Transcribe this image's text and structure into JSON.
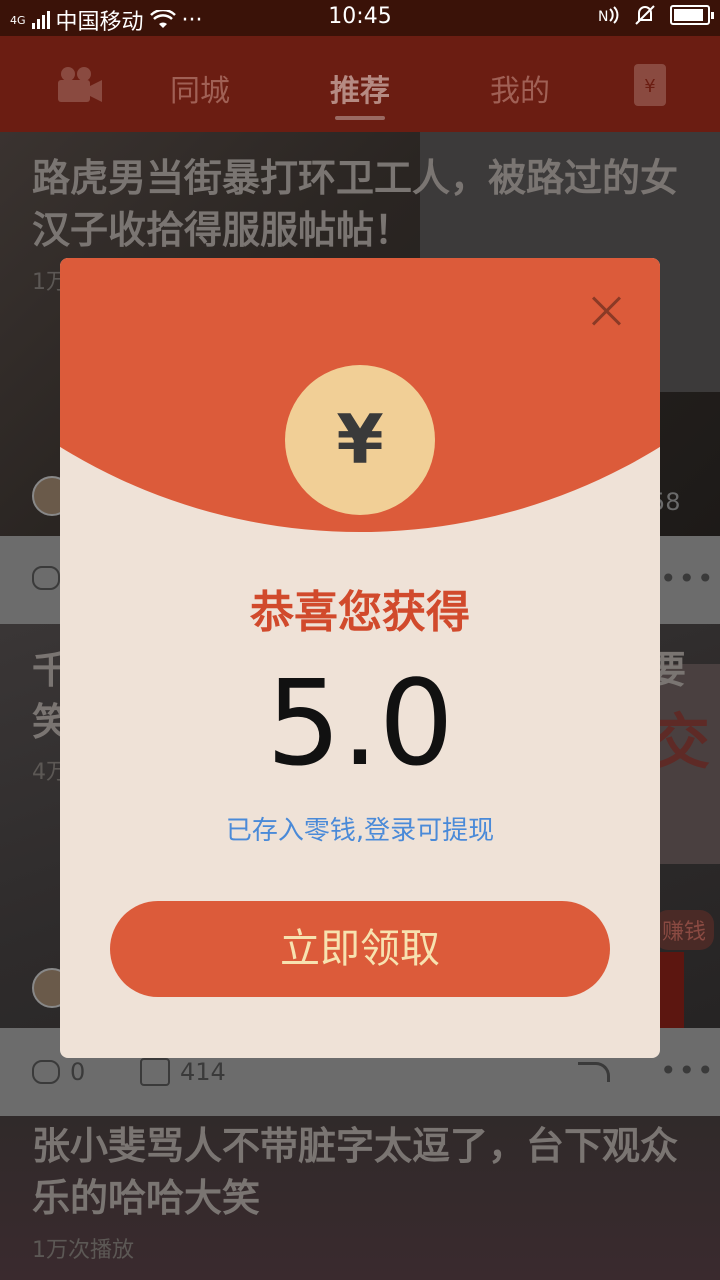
{
  "status_bar": {
    "network_type": "4G",
    "carrier": "中国移动",
    "more": "···",
    "time": "10:45",
    "battery_level": 0.9
  },
  "nav": {
    "tabs": [
      {
        "label": "同城"
      },
      {
        "label": "推荐",
        "active": true
      },
      {
        "label": "我的"
      }
    ],
    "camera_icon": "video-camera-icon",
    "red_packet_icon": "red-packet-icon",
    "red_packet_glyph": "¥"
  },
  "feed": {
    "items": [
      {
        "title": "路虎男当街暴打环卫工人，被路过的女汉子收拾得服服帖帖！",
        "meta": "1万",
        "right_count": "58"
      },
      {
        "title": "千",
        "title_line2": "笑",
        "meta": "4万",
        "right_title_char": "要",
        "banner_text": "交",
        "badge": "赚钱",
        "comments": "0",
        "likes": "414"
      },
      {
        "title": "张小斐骂人不带脏字太逗了，台下观众乐的哈哈大笑",
        "meta": "1万次播放"
      }
    ]
  },
  "modal": {
    "coin_symbol": "¥",
    "congrats": "恭喜您获得",
    "amount": "5.0",
    "note": "已存入零钱,登录可提现",
    "claim_button": "立即领取",
    "colors": {
      "header": "#dc5b3a",
      "body": "#efe2d7",
      "coin": "#f1cf96",
      "note": "#4a8ad8",
      "button_text": "#f7e2b0"
    }
  }
}
